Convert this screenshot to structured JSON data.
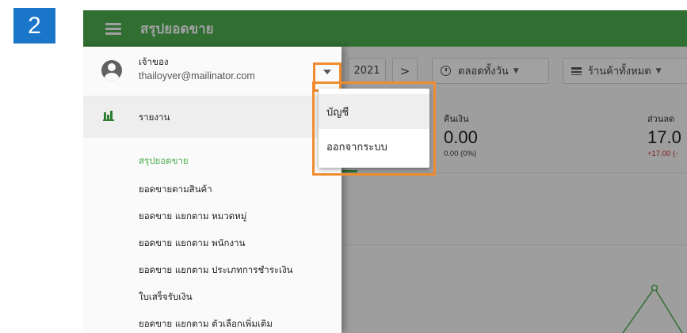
{
  "step_number": "2",
  "app": {
    "title": "สรุปยอดขาย",
    "primary_color": "#4caf50",
    "highlight_color": "#f08c2e",
    "step_color": "#1a76c9"
  },
  "drawer": {
    "user": {
      "role": "เจ้าของ",
      "email": "thailoyver@mailinator.com",
      "avatar_icon": "account-circle-icon",
      "dropdown_icon": "caret-down-icon"
    },
    "report_section": {
      "label": "รายงาน",
      "icon": "bar-chart-icon"
    },
    "sub_items": [
      {
        "label": "สรุปยอดขาย",
        "active": true
      },
      {
        "label": "ยอดขายตามสินค้า",
        "active": false
      },
      {
        "label": "ยอดขาย แยกตาม หมวดหมู่",
        "active": false
      },
      {
        "label": "ยอดขาย แยกตาม พนักงาน",
        "active": false
      },
      {
        "label": "ยอดขาย แยกตาม ประเภทการชำระเงิน",
        "active": false
      },
      {
        "label": "ใบเสร็จรับเงิน",
        "active": false
      },
      {
        "label": "ยอดขาย แยกตาม ตัวเลือกเพิ่มเติม",
        "active": false
      }
    ]
  },
  "popup_menu": {
    "items": [
      {
        "label": "บัญชี"
      },
      {
        "label": "ออกจากระบบ"
      }
    ]
  },
  "filters": {
    "date_partial": "2021",
    "next_label": ">",
    "time_label": "ตลอดทั้งวัน",
    "store_label": "ร้านค้าทั้งหมด"
  },
  "stats": [
    {
      "label": "คืนเงิน",
      "value": "0.00",
      "sub": "0.00 (0%)",
      "sub_color": "normal"
    },
    {
      "label": "ส่วนลด",
      "value": "17.0",
      "sub": "+17.00 (-",
      "sub_color": "red"
    }
  ]
}
